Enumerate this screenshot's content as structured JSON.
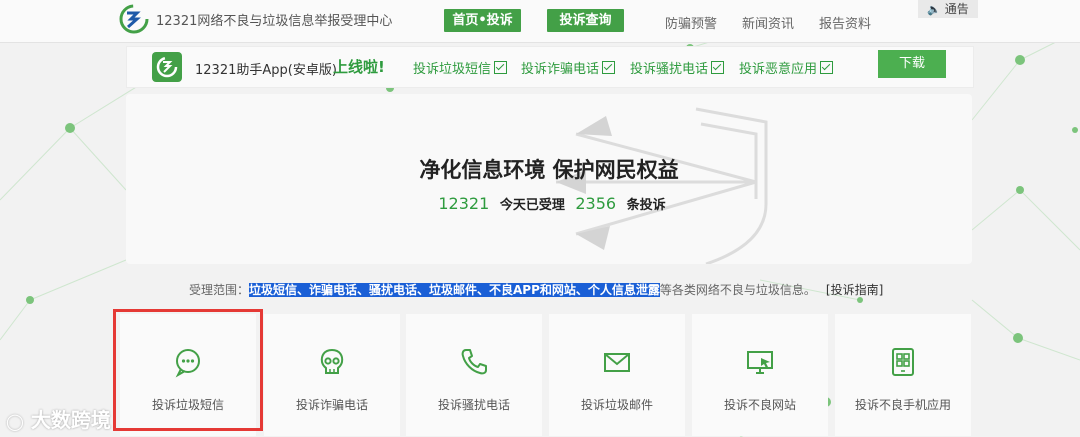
{
  "header": {
    "site_title": "12321网络不良与垃圾信息举报受理中心",
    "nav_buttons": [
      "首页•投诉",
      "投诉查询"
    ],
    "nav_links": [
      "防骗预警",
      "新闻资讯",
      "报告资料"
    ],
    "notice": "通告"
  },
  "banner": {
    "title": "12321助手App(安卓版)",
    "highlight": "上线啦!",
    "features": [
      "投诉垃圾短信",
      "投诉诈骗电话",
      "投诉骚扰电话",
      "投诉恶意应用"
    ],
    "download": "下载"
  },
  "hero": {
    "slogan": "净化信息环境 保护网民权益",
    "hotline": "12321",
    "today_label": "今天已受理",
    "today_count": "2356",
    "count_suffix": "条投诉"
  },
  "scope": {
    "label": "受理范围：",
    "highlighted": "垃圾短信、诈骗电话、骚扰电话、垃圾邮件、不良APP和网站、个人信息泄露",
    "rest": "等各类网络不良与垃圾信息。",
    "guide": "[投诉指南]"
  },
  "cards": [
    {
      "label": "投诉垃圾短信",
      "icon": "chat-bubble-icon"
    },
    {
      "label": "投诉诈骗电话",
      "icon": "skull-icon"
    },
    {
      "label": "投诉骚扰电话",
      "icon": "phone-icon"
    },
    {
      "label": "投诉垃圾邮件",
      "icon": "envelope-icon"
    },
    {
      "label": "投诉不良网站",
      "icon": "monitor-icon"
    },
    {
      "label": "投诉不良手机应用",
      "icon": "app-grid-icon"
    }
  ],
  "watermark": "大数跨境",
  "colors": {
    "accent": "#43a047",
    "highlight": "#1a5fd6",
    "frame": "#e53935"
  }
}
